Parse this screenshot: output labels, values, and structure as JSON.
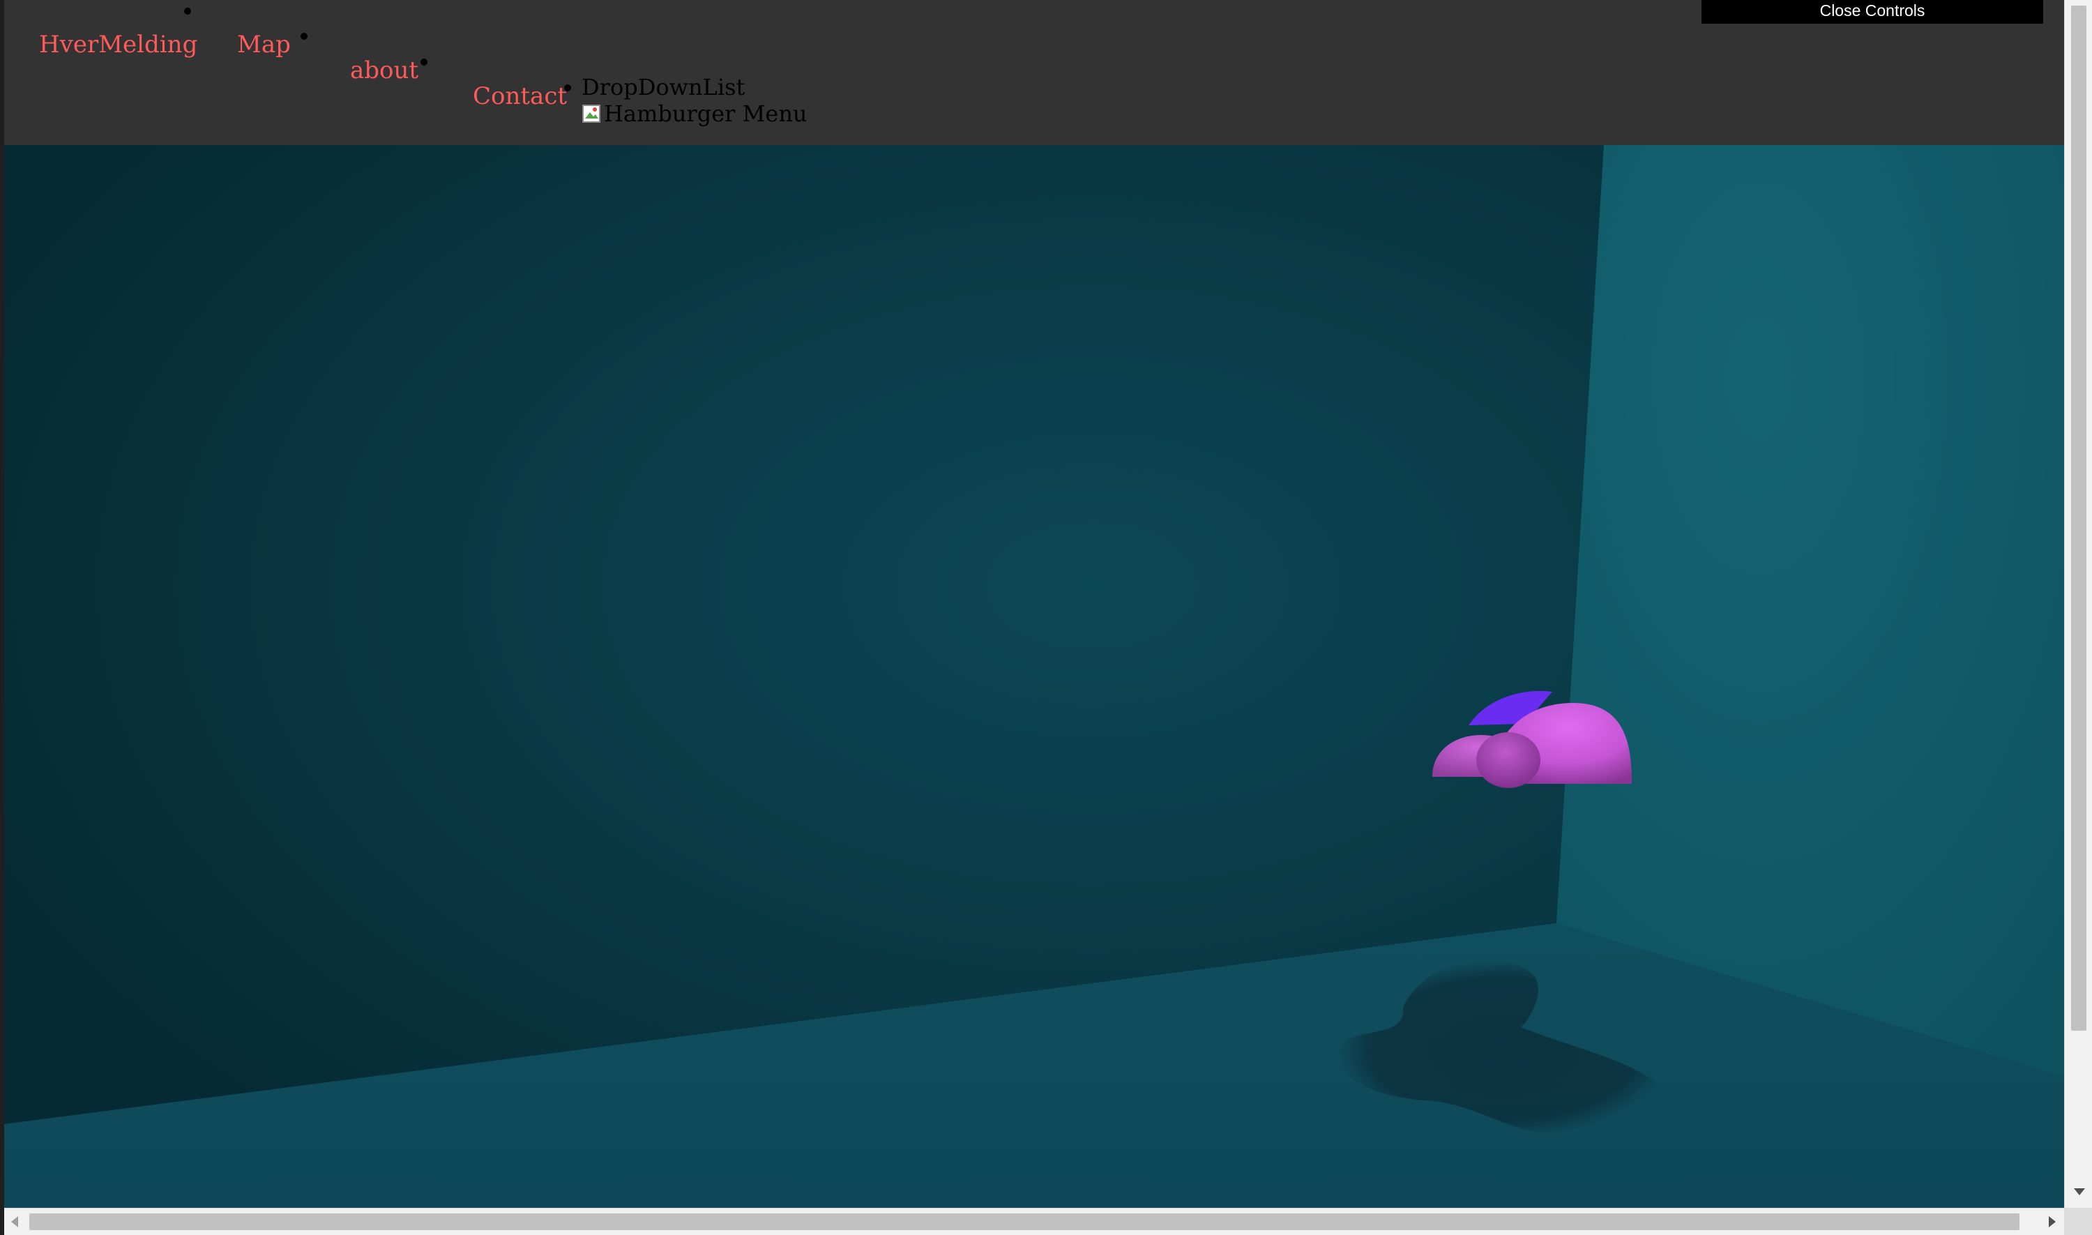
{
  "nav": {
    "links": [
      {
        "label": "HverMelding"
      },
      {
        "label": "Map"
      },
      {
        "label": "about"
      },
      {
        "label": "Contact"
      }
    ],
    "dropdown_label": "DropDownList",
    "hamburger_alt": "Hamburger Menu"
  },
  "controls": {
    "close_label": "Close Controls"
  },
  "icons": {
    "hamburger": "broken-image-icon",
    "scroll_down": "chevron-down-icon",
    "scroll_left": "chevron-left-icon",
    "scroll_right": "chevron-right-icon"
  },
  "colors": {
    "nav_background": "#333333",
    "nav_link": "#ff5a5a",
    "scene_wall_left": "#0a3440",
    "scene_wall_right": "#0f5462",
    "scene_floor": "#0f4a5a",
    "object_main": "#c95ad6",
    "object_accent": "#6b2cf2"
  }
}
